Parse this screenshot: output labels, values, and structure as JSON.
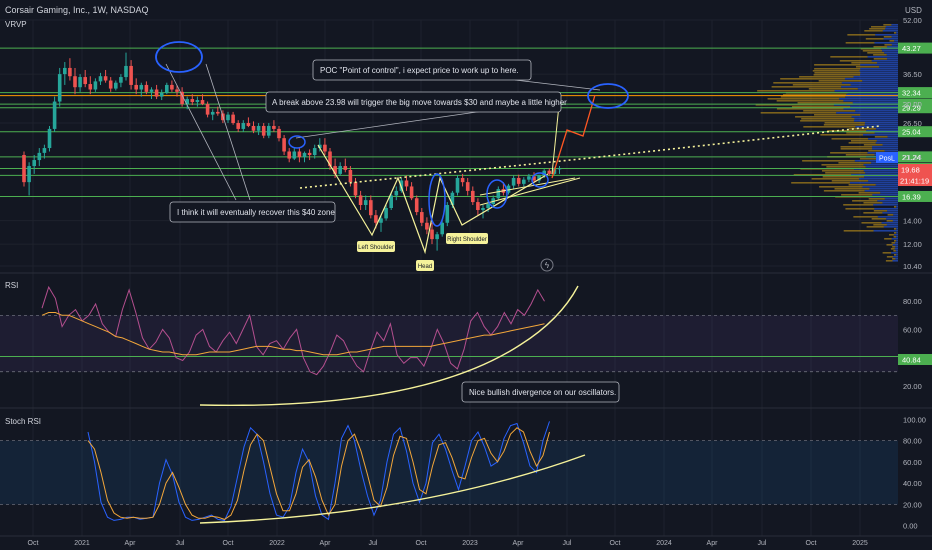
{
  "header": {
    "title": "Corsair Gaming, Inc., 1W, NASDAQ",
    "currency": "USD",
    "indicator": "VRVP"
  },
  "colors": {
    "background": "#131722",
    "bull": "#26a69a",
    "bear": "#ef5350",
    "hline": "#4caf50",
    "annot": "#f5f29a",
    "arrow": "#ff5722",
    "ring": "#2962ff",
    "rsi": "#b44f8f",
    "rsi_ma": "#f2a63a",
    "stoch_k": "#2962ff",
    "stoch_d": "#f2a63a"
  },
  "chart_data": [
    {
      "type": "candlestick",
      "title": "Corsair Gaming, Inc., 1W, NASDAQ",
      "ylim": [
        10.4,
        52.0
      ],
      "y_scale": "log",
      "y_ticks": [
        "52.00",
        "36.50",
        "30.00",
        "26.50",
        "21.24",
        "14.00",
        "12.00",
        "10.40"
      ],
      "x_ticks": [
        "Oct",
        "2021",
        "Apr",
        "Jul",
        "Oct",
        "2022",
        "Apr",
        "Jul",
        "Oct",
        "2023",
        "Apr",
        "Jul",
        "Oct",
        "2024",
        "Apr",
        "Jul",
        "Oct",
        "2025"
      ],
      "candles": [
        [
          21.5,
          22.0,
          17.5,
          18.0
        ],
        [
          18.0,
          20.5,
          16.5,
          20.0
        ],
        [
          20.0,
          21.5,
          19.0,
          20.8
        ],
        [
          20.8,
          22.5,
          20.0,
          21.8
        ],
        [
          21.8,
          23.0,
          21.0,
          22.5
        ],
        [
          22.5,
          26.0,
          22.0,
          25.5
        ],
        [
          25.5,
          31.5,
          25.0,
          30.5
        ],
        [
          30.5,
          38.0,
          29.5,
          36.5
        ],
        [
          36.5,
          39.5,
          34.0,
          38.0
        ],
        [
          38.0,
          40.5,
          35.0,
          36.0
        ],
        [
          36.0,
          38.0,
          32.0,
          33.5
        ],
        [
          33.5,
          36.5,
          32.5,
          35.8
        ],
        [
          35.8,
          37.5,
          33.5,
          34.2
        ],
        [
          34.2,
          36.0,
          32.0,
          33.0
        ],
        [
          33.0,
          35.5,
          32.5,
          34.8
        ],
        [
          34.8,
          36.8,
          34.0,
          36.0
        ],
        [
          36.0,
          37.5,
          34.5,
          35.0
        ],
        [
          35.0,
          35.8,
          32.5,
          33.2
        ],
        [
          33.2,
          35.0,
          32.8,
          34.5
        ],
        [
          34.5,
          36.5,
          33.5,
          35.8
        ],
        [
          35.8,
          42.0,
          35.0,
          38.5
        ],
        [
          38.5,
          40.0,
          33.0,
          34.0
        ],
        [
          34.0,
          35.5,
          32.0,
          33.0
        ],
        [
          33.0,
          34.5,
          31.5,
          34.0
        ],
        [
          34.0,
          34.8,
          32.0,
          32.5
        ],
        [
          32.5,
          33.5,
          31.0,
          33.0
        ],
        [
          33.0,
          34.0,
          31.0,
          31.5
        ],
        [
          31.5,
          33.0,
          30.8,
          32.3
        ],
        [
          32.3,
          34.5,
          32.0,
          34.0
        ],
        [
          34.0,
          35.0,
          32.5,
          33.0
        ],
        [
          33.0,
          34.0,
          31.5,
          32.5
        ],
        [
          32.5,
          33.5,
          29.5,
          30.0
        ],
        [
          30.0,
          31.5,
          29.0,
          31.0
        ],
        [
          31.0,
          32.0,
          29.8,
          30.4
        ],
        [
          30.4,
          31.5,
          29.5,
          30.8
        ],
        [
          30.8,
          32.0,
          29.8,
          30.0
        ],
        [
          30.0,
          30.5,
          27.5,
          28.0
        ],
        [
          28.0,
          29.0,
          27.0,
          28.5
        ],
        [
          28.5,
          29.5,
          27.8,
          28.2
        ],
        [
          28.2,
          28.8,
          26.5,
          27.0
        ],
        [
          27.0,
          28.5,
          26.5,
          28.0
        ],
        [
          28.0,
          28.5,
          26.2,
          26.5
        ],
        [
          26.5,
          27.0,
          25.0,
          25.5
        ],
        [
          25.5,
          27.0,
          25.0,
          26.5
        ],
        [
          26.5,
          27.5,
          25.8,
          26.0
        ],
        [
          26.0,
          26.8,
          24.8,
          25.2
        ],
        [
          25.2,
          26.5,
          24.5,
          26.0
        ],
        [
          26.0,
          26.5,
          24.0,
          24.4
        ],
        [
          24.4,
          26.5,
          24.0,
          26.0
        ],
        [
          26.0,
          27.0,
          25.0,
          25.5
        ],
        [
          25.5,
          26.0,
          23.5,
          24.0
        ],
        [
          24.0,
          24.5,
          21.5,
          22.0
        ],
        [
          22.0,
          22.5,
          20.5,
          21.0
        ],
        [
          21.0,
          22.5,
          20.8,
          22.0
        ],
        [
          22.0,
          22.5,
          20.5,
          21.2
        ],
        [
          21.2,
          22.0,
          20.5,
          21.8
        ],
        [
          21.8,
          22.3,
          20.8,
          21.5
        ],
        [
          21.5,
          23.0,
          21.0,
          22.5
        ],
        [
          22.5,
          24.0,
          22.0,
          23.0
        ],
        [
          23.0,
          24.0,
          21.5,
          22.0
        ],
        [
          22.0,
          22.5,
          19.5,
          20.0
        ],
        [
          20.0,
          21.0,
          18.5,
          19.0
        ],
        [
          19.0,
          20.5,
          18.8,
          20.0
        ],
        [
          20.0,
          21.0,
          19.2,
          19.5
        ],
        [
          19.5,
          20.0,
          17.5,
          18.0
        ],
        [
          18.0,
          18.5,
          16.2,
          16.5
        ],
        [
          16.5,
          17.0,
          15.0,
          15.5
        ],
        [
          15.5,
          16.5,
          15.0,
          16.0
        ],
        [
          16.0,
          16.5,
          14.2,
          14.5
        ],
        [
          14.5,
          15.0,
          13.3,
          13.8
        ],
        [
          13.8,
          14.5,
          13.0,
          14.2
        ],
        [
          14.2,
          15.5,
          14.0,
          15.2
        ],
        [
          15.2,
          16.8,
          15.0,
          16.5
        ],
        [
          16.5,
          17.5,
          16.0,
          17.0
        ],
        [
          17.0,
          18.5,
          16.8,
          18.2
        ],
        [
          18.2,
          18.8,
          17.0,
          17.5
        ],
        [
          17.5,
          18.0,
          16.0,
          16.2
        ],
        [
          16.2,
          16.5,
          14.5,
          14.8
        ],
        [
          14.8,
          15.2,
          13.5,
          13.8
        ],
        [
          13.8,
          14.3,
          12.8,
          13.2
        ],
        [
          13.2,
          13.8,
          12.0,
          12.4
        ],
        [
          12.4,
          13.0,
          11.5,
          12.8
        ],
        [
          12.8,
          14.0,
          12.6,
          13.8
        ],
        [
          13.8,
          15.8,
          13.5,
          15.5
        ],
        [
          15.5,
          17.0,
          15.2,
          16.8
        ],
        [
          16.8,
          18.8,
          16.5,
          18.5
        ],
        [
          18.5,
          19.0,
          17.5,
          18.0
        ],
        [
          18.0,
          18.5,
          16.5,
          17.0
        ],
        [
          17.0,
          17.5,
          15.5,
          15.8
        ],
        [
          15.8,
          16.2,
          14.5,
          15.0
        ],
        [
          15.0,
          15.5,
          14.2,
          15.2
        ],
        [
          15.2,
          16.0,
          14.8,
          15.6
        ],
        [
          15.6,
          16.5,
          15.2,
          16.2
        ],
        [
          16.2,
          17.5,
          16.0,
          17.2
        ],
        [
          17.2,
          18.0,
          16.5,
          16.8
        ],
        [
          16.8,
          17.8,
          16.6,
          17.6
        ],
        [
          17.6,
          18.8,
          17.2,
          18.5
        ],
        [
          18.5,
          18.9,
          17.5,
          17.8
        ],
        [
          17.8,
          18.6,
          17.5,
          18.3
        ],
        [
          18.3,
          19.0,
          18.0,
          18.7
        ],
        [
          18.7,
          19.2,
          18.0,
          18.2
        ],
        [
          18.2,
          18.9,
          17.9,
          18.8
        ],
        [
          18.8,
          19.6,
          18.5,
          19.4
        ],
        [
          19.4,
          19.7,
          18.8,
          19.0
        ],
        [
          19.0,
          19.8,
          18.9,
          19.6
        ],
        [
          19.6,
          20.0,
          19.0,
          19.7
        ]
      ],
      "horizontal_levels": [
        {
          "value": 43.27,
          "label": "43.27"
        },
        {
          "value": 32.34,
          "label": "32.34"
        },
        {
          "value": 30.0,
          "label": "30.00"
        },
        {
          "value": 29.29,
          "label": "29.29"
        },
        {
          "value": 25.04,
          "label": "25.04"
        },
        {
          "value": 21.24,
          "label": "21.24"
        },
        {
          "value": 19.68,
          "label": "19.68"
        },
        {
          "value": 18.82,
          "label": "18.82"
        },
        {
          "value": 16.39,
          "label": "16.39"
        }
      ],
      "last_price_label": "19.68",
      "countdown_label": "21:41:19",
      "pos_label": "PosL",
      "annotations": [
        "POC \"Point of control\", i expect price to work up to here.",
        "A break above 23.98 will trigger the big move towards $30 and maybe a little higher",
        "I think it will eventually recover this $40 zone",
        "Left Shoulder",
        "Head",
        "Right Shoulder"
      ]
    },
    {
      "type": "line",
      "title": "RSI",
      "ylim": [
        10,
        95
      ],
      "y_ticks": [
        "80.00",
        "60.00",
        "40.84",
        "20.00"
      ],
      "band": [
        30,
        70
      ],
      "level_label": "40.84",
      "annotation": "Nice bullish divergence on our oscillators.",
      "series": [
        {
          "values": [
            75,
            90,
            82,
            62,
            70,
            74,
            66,
            70,
            78,
            64,
            58,
            55,
            74,
            88,
            72,
            54,
            46,
            51,
            60,
            54,
            40,
            38,
            44,
            56,
            60,
            48,
            44,
            52,
            58,
            50,
            60,
            70,
            48,
            42,
            50,
            52,
            46,
            54,
            60,
            40,
            30,
            28,
            34,
            44,
            56,
            52,
            42,
            34,
            30,
            45,
            58,
            52,
            64,
            42,
            36,
            40,
            40,
            34,
            46,
            60,
            50,
            36,
            32,
            46,
            66,
            72,
            62,
            56,
            62,
            72,
            64,
            74,
            70,
            78,
            88,
            80
          ]
        },
        {
          "values": [
            70,
            72,
            72,
            70,
            70,
            68,
            66,
            64,
            62,
            60,
            58,
            55,
            54,
            52,
            50,
            48,
            46,
            45,
            44,
            44,
            43,
            42,
            42,
            42,
            43,
            44,
            44,
            44,
            44,
            45,
            46,
            47,
            48,
            48,
            48,
            47,
            46,
            46,
            45,
            45,
            44,
            43,
            42,
            42,
            42,
            43,
            44,
            44,
            45,
            46,
            47,
            48,
            48,
            48,
            48,
            48,
            48,
            48,
            48,
            49,
            50,
            51,
            52,
            53,
            54,
            55,
            56,
            56,
            57,
            58,
            59,
            60,
            61,
            62,
            63,
            64
          ]
        }
      ]
    },
    {
      "type": "line",
      "title": "Stoch RSI",
      "ylim": [
        -4,
        104
      ],
      "y_ticks": [
        "100.00",
        "80.00",
        "60.00",
        "40.00",
        "20.00",
        "0.00"
      ],
      "band": [
        20,
        80
      ],
      "series": [
        {
          "values": [
            88,
            60,
            22,
            8,
            5,
            6,
            8,
            8,
            6,
            7,
            8,
            40,
            62,
            48,
            22,
            8,
            5,
            6,
            8,
            10,
            6,
            5,
            18,
            46,
            74,
            92,
            86,
            60,
            30,
            10,
            8,
            18,
            50,
            72,
            60,
            28,
            10,
            6,
            40,
            82,
            94,
            80,
            52,
            28,
            10,
            24,
            60,
            86,
            92,
            70,
            40,
            22,
            40,
            78,
            86,
            72,
            52,
            34,
            56,
            80,
            88,
            74,
            56,
            60,
            82,
            94,
            96,
            78,
            56,
            50,
            80,
            98
          ]
        },
        {
          "values": [
            80,
            72,
            50,
            24,
            12,
            8,
            7,
            8,
            7,
            7,
            8,
            20,
            40,
            50,
            36,
            20,
            10,
            7,
            7,
            9,
            8,
            6,
            10,
            24,
            52,
            76,
            86,
            80,
            55,
            30,
            14,
            14,
            30,
            55,
            62,
            46,
            24,
            10,
            20,
            56,
            80,
            86,
            70,
            48,
            24,
            18,
            36,
            66,
            84,
            82,
            60,
            34,
            30,
            56,
            76,
            78,
            64,
            46,
            44,
            64,
            80,
            82,
            68,
            60,
            70,
            86,
            92,
            88,
            70,
            56,
            66,
            88
          ]
        }
      ]
    }
  ]
}
